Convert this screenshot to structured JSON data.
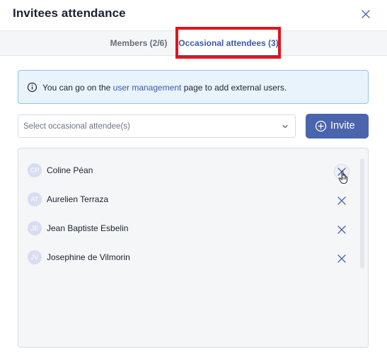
{
  "header": {
    "title": "Invitees attendance",
    "close_icon": "close-icon"
  },
  "tabs": [
    {
      "label": "Members (2/6)",
      "active": false
    },
    {
      "label": "Occasional attendees (3)",
      "active": true
    }
  ],
  "info": {
    "icon": "info-circle-icon",
    "text_before": "You can go on the",
    "link": "user management",
    "text_after": "page to add external users."
  },
  "select": {
    "placeholder": "Select occasional attendee(s)",
    "icon": "chevron-down-icon"
  },
  "invite_button": {
    "label": "Invite",
    "icon": "plus-circle-icon"
  },
  "attendees": [
    {
      "initials": "CP",
      "name": "Coline Péan",
      "hovered": true
    },
    {
      "initials": "AT",
      "name": "Aurelien Terraza",
      "hovered": false
    },
    {
      "initials": "JE",
      "name": "Jean Baptiste Esbelin",
      "hovered": false
    },
    {
      "initials": "JV",
      "name": "Josephine de Vilmorin",
      "hovered": false
    }
  ],
  "colors": {
    "accent": "#4a64ad",
    "highlight": "#e1141b",
    "info_bg": "#e8f3fc",
    "info_border": "#8ec5ea"
  }
}
